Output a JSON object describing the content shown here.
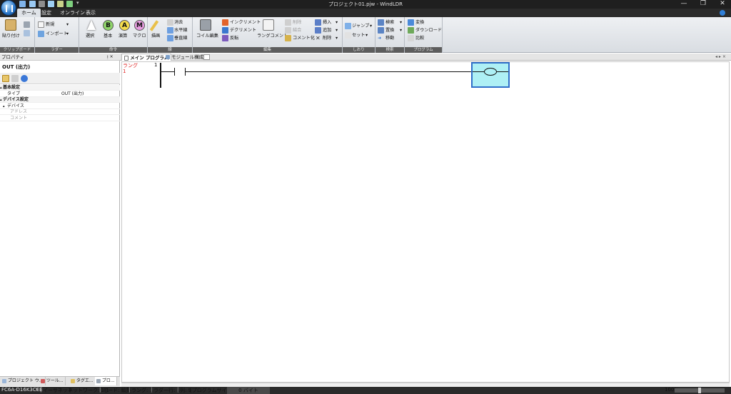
{
  "window": {
    "title": "プロジェクト01.pjw - WindLDR",
    "minimize_glyph": "—",
    "restore_glyph": "❐",
    "close_glyph": "✕"
  },
  "ribbon_tabs": [
    "ホーム",
    "設定",
    "オンライン",
    "表示"
  ],
  "ribbon": {
    "clipboard": {
      "paste": "貼り付け",
      "label": "クリップボード"
    },
    "ladder": {
      "new": "新規",
      "import": "インポート",
      "label": "ラダー"
    },
    "command": {
      "select": "選択",
      "basic": "基本",
      "calc": "演算",
      "macro": "マクロ",
      "label": "命令",
      "icon_b": "B",
      "icon_a": "A",
      "icon_m": "M"
    },
    "line": {
      "draw": "描画",
      "delete": "消去",
      "hline": "水平線",
      "vline": "垂直線",
      "label": "線"
    },
    "edit": {
      "coil_edit": "コイル編集",
      "increment": "インクリメント",
      "decrement": "デクリメント",
      "invert": "反転",
      "rung_comment": "ラングコメント",
      "delete": "削除",
      "merge": "結合",
      "comment_out": "コメント化",
      "insert": "挿入",
      "add": "追加",
      "remove": "削除",
      "label": "編集"
    },
    "bookmark": {
      "jump": "ジャンプ",
      "set": "セット",
      "label": "しおり"
    },
    "search": {
      "find": "検索",
      "replace": "置換",
      "move": "移動",
      "label": "検索"
    },
    "program": {
      "convert": "変換",
      "download": "ダウンロード",
      "compare": "比較",
      "label": "プログラム"
    }
  },
  "left_panel": {
    "title": "プロパティ",
    "pin": "ᴉ ×",
    "heading": "OUT (出力)",
    "rows": [
      {
        "key": "基本設定",
        "value": "",
        "category": true
      },
      {
        "key": "タイプ",
        "value": "OUT (出力)",
        "category": false
      },
      {
        "key": "デバイス設定",
        "value": "",
        "category": true
      },
      {
        "key": "デバイス",
        "value": "",
        "category": false
      },
      {
        "key": "アドレス",
        "value": "",
        "category": false
      },
      {
        "key": "コメント",
        "value": "",
        "category": false
      }
    ],
    "tabs": [
      "プロジェクト ウ...",
      "ツール...",
      "タグエ...",
      "プロ..."
    ]
  },
  "doc_tabs": [
    "メイン プログラム",
    "モジュール構成"
  ],
  "editor": {
    "rung_label": "ラング",
    "rung_number": "1",
    "line_number": "1",
    "scroll_arrows": "◂ ▸ ×"
  },
  "status_bar": {
    "plc": "FC6A-D16K3CEE",
    "conn": "イーサネット",
    "network": "ネットワーク: 1:1",
    "mode": "モード: 編集",
    "rung": "ラング: 1",
    "ladder_row": "ラダー行: 1",
    "col": "列: 9",
    "prog_size": "[プログラムサイズ:",
    "bytes": "0 バイト",
    "zoom": "100%"
  },
  "colors": {
    "accent": "#2f6fc9",
    "coil_fill": "#aef0f5",
    "rung_red": "#e02020"
  }
}
